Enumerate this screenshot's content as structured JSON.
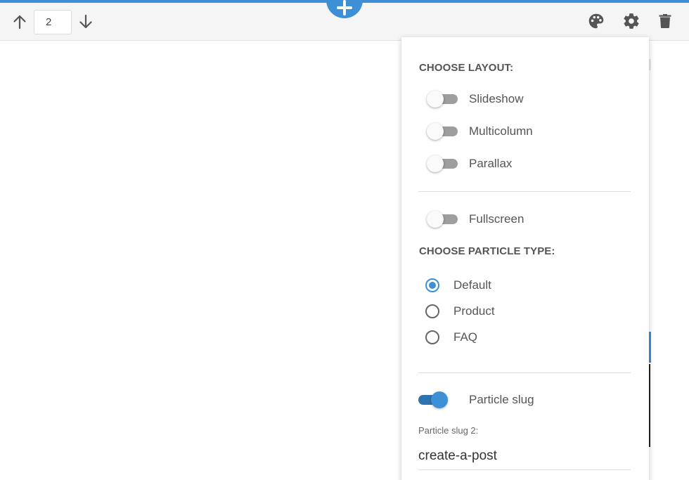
{
  "toolbar": {
    "order_value": "2",
    "icons": {
      "move_up": "arrow-up-icon",
      "move_down": "arrow-down-icon",
      "add": "plus-icon",
      "theme": "palette-icon",
      "settings": "gear-icon",
      "delete": "trash-icon"
    }
  },
  "panel": {
    "layout_heading": "CHOOSE LAYOUT:",
    "layout_options": [
      {
        "label": "Slideshow",
        "on": false
      },
      {
        "label": "Multicolumn",
        "on": false
      },
      {
        "label": "Parallax",
        "on": false
      }
    ],
    "fullscreen": {
      "label": "Fullscreen",
      "on": false
    },
    "particle_heading": "CHOOSE PARTICLE TYPE:",
    "particle_types": [
      {
        "label": "Default",
        "checked": true
      },
      {
        "label": "Product",
        "checked": false
      },
      {
        "label": "FAQ",
        "checked": false
      }
    ],
    "slug_toggle": {
      "label": "Particle slug",
      "on": true
    },
    "slug_field": {
      "label": "Particle slug 2:",
      "value": "create-a-post"
    }
  },
  "colors": {
    "accent": "#3d8fd6",
    "accent_dark": "#2f72b0",
    "toolbar_bg": "#f5f5f5",
    "icon": "#555555"
  }
}
